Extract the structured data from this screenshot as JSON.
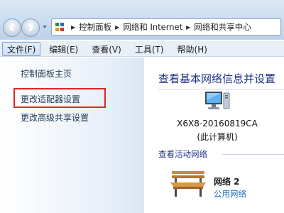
{
  "navigation": {
    "back_icon": "back-arrow-icon",
    "forward_icon": "forward-arrow-icon",
    "recent_icon": "chevron-down-icon"
  },
  "address_bar": {
    "icon": "control-panel-icon",
    "breadcrumbs": [
      "控制面板",
      "网络和 Internet",
      "网络和共享中心"
    ]
  },
  "menu": {
    "items": [
      "文件(F)",
      "编辑(E)",
      "查看(V)",
      "工具(T)",
      "帮助(H)"
    ]
  },
  "sidebar": {
    "items": [
      "控制面板主页",
      "更改适配器设置",
      "更改高级共享设置"
    ],
    "highlight_color": "#e0261f"
  },
  "main": {
    "heading": "查看基本网络信息并设置",
    "computer": {
      "icon": "computer-icon",
      "name": "X6X8-20160819CA",
      "sub": "(此计算机)"
    },
    "active_networks_label": "查看活动网络",
    "network": {
      "icon": "park-bench-icon",
      "name": "网络  2",
      "type": "公用网络"
    }
  },
  "colors": {
    "link": "#1f6bbf",
    "heading": "#1e3287",
    "highlight": "#e0261f"
  }
}
